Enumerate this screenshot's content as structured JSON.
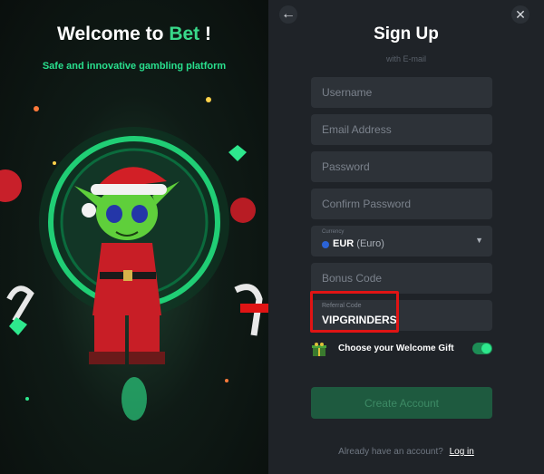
{
  "promo": {
    "title_prefix": "Welcome to",
    "title_brand": "Bet",
    "title_suffix": "!",
    "subtitle": "Safe and innovative gambling platform"
  },
  "form": {
    "title": "Sign Up",
    "subtitle": "with E-mail",
    "username_placeholder": "Username",
    "email_placeholder": "Email Address",
    "password_placeholder": "Password",
    "confirm_placeholder": "Confirm Password",
    "currency": {
      "label": "Currency",
      "code": "EUR",
      "name": "(Euro)"
    },
    "bonus_placeholder": "Bonus Code",
    "referral": {
      "label": "Referral Code",
      "value": "VIPGRINDERS"
    },
    "welcome_gift_label": "Choose your Welcome Gift",
    "welcome_gift_enabled": true,
    "create_button": "Create Account",
    "login_prompt": "Already have an account?",
    "login_link": "Log in"
  },
  "icons": {
    "back": "arrow-left-icon",
    "close": "close-icon",
    "currency_flag": "eu-flag-icon",
    "caret": "chevron-down-icon",
    "gift": "gift-icon"
  },
  "colors": {
    "accent": "#2ee88d",
    "highlight": "#e01414",
    "panel": "#1f2328",
    "field": "#2d3238"
  }
}
